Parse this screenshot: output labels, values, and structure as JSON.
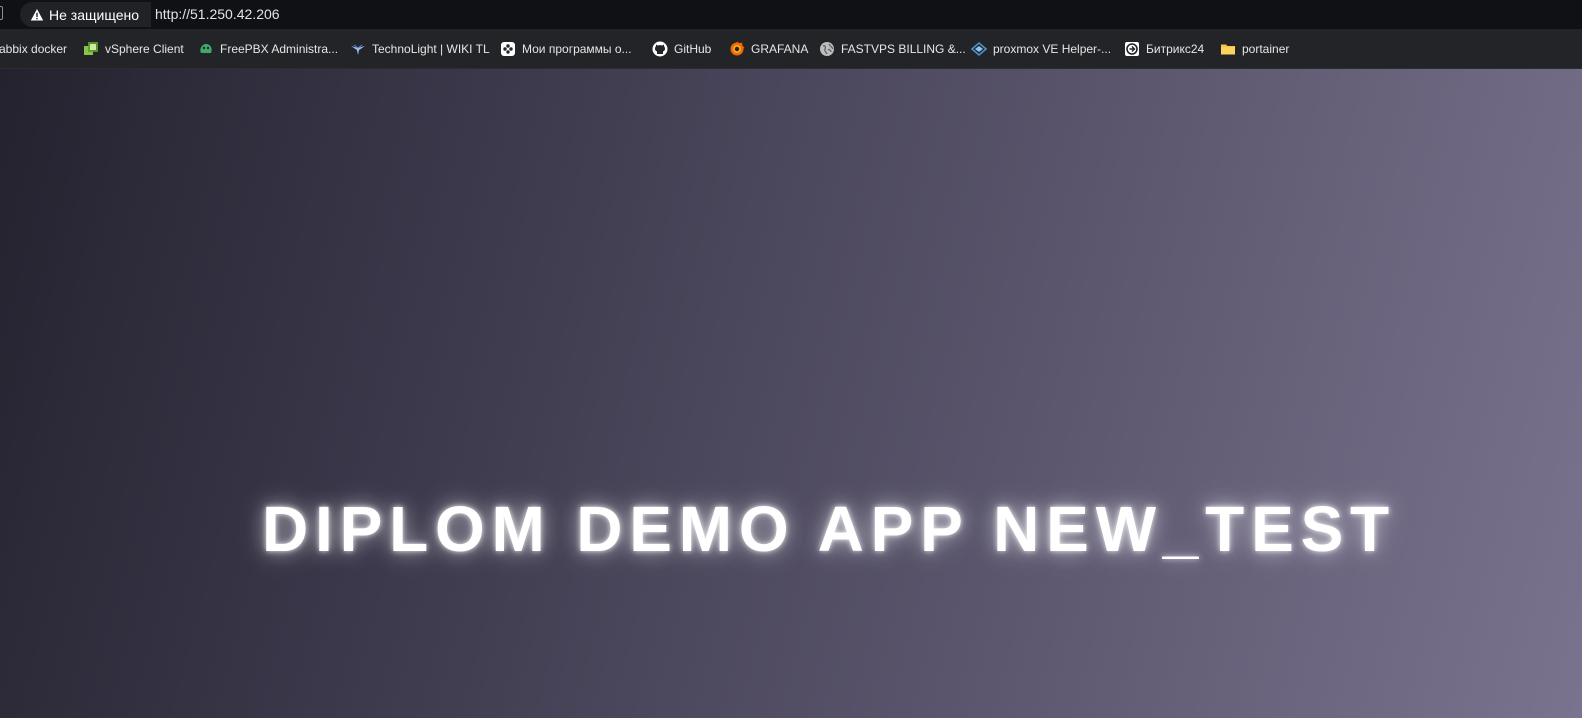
{
  "address_bar": {
    "security_label": "Не защищено",
    "url": "http://51.250.42.206"
  },
  "bookmarks": [
    {
      "label": "abbix docker",
      "icon": "zabbix-icon"
    },
    {
      "label": "vSphere Client",
      "icon": "vsphere-icon"
    },
    {
      "label": "FreePBX Administra...",
      "icon": "freepbx-icon"
    },
    {
      "label": "TechnoLight | WIKI TL",
      "icon": "technolight-icon"
    },
    {
      "label": "Мои программы о...",
      "icon": "programs-icon"
    },
    {
      "label": "GitHub",
      "icon": "github-icon"
    },
    {
      "label": "GRAFANA",
      "icon": "grafana-icon"
    },
    {
      "label": "FASTVPS BILLING &...",
      "icon": "globe-icon"
    },
    {
      "label": "proxmox VE Helper-...",
      "icon": "proxmox-icon"
    },
    {
      "label": "Битрикс24",
      "icon": "bitrix24-icon"
    },
    {
      "label": "portainer",
      "icon": "folder-icon"
    }
  ],
  "page": {
    "headline": "DIPLOM DEMO APP NEW_TEST"
  },
  "colors": {
    "address_bar_bg": "#0f1114",
    "bookmarks_bar_bg": "#232427",
    "page_gradient_start": "#25222f",
    "page_gradient_end": "#7a738f",
    "headline": "#ffffff"
  }
}
